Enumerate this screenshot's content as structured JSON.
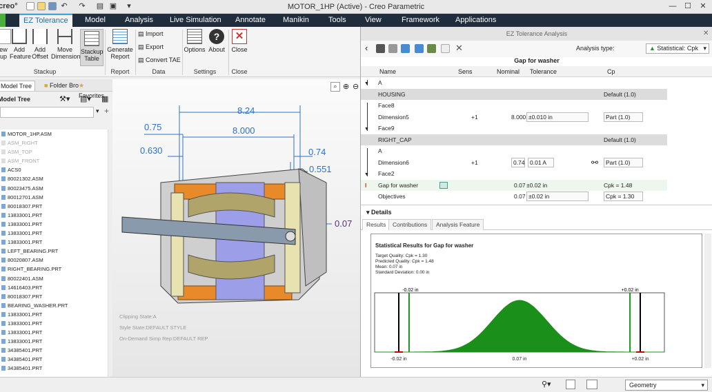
{
  "app": {
    "logo": "creo°",
    "title": "MOTOR_1HP (Active) - Creo Parametric"
  },
  "menu": [
    "EZ Tolerance",
    "Model",
    "Analysis",
    "Live Simulation",
    "Annotate",
    "Manikin",
    "Tools",
    "View",
    "Framework",
    "Applications"
  ],
  "ribbon": {
    "buttons": [
      {
        "label": "ew",
        "label2": "up"
      },
      {
        "label": "Add",
        "label2": "Feature"
      },
      {
        "label": "Add",
        "label2": "Offset"
      },
      {
        "label": "Move",
        "label2": "Dimension"
      },
      {
        "label": "Stackup",
        "label2": "Table"
      },
      {
        "label": "Generate",
        "label2": "Report"
      },
      {
        "label": "Options",
        "label2": ""
      },
      {
        "label": "About",
        "label2": ""
      },
      {
        "label": "Close",
        "label2": ""
      }
    ],
    "data_items": [
      "Import",
      "Export",
      "Convert TAE"
    ],
    "groups": [
      "Stackup",
      "Report",
      "Data",
      "Settings",
      "Close"
    ]
  },
  "left": {
    "tabs": [
      "Model Tree",
      "Folder Bro",
      "Favorites"
    ],
    "tree_title": "Model Tree",
    "tree": [
      {
        "label": "MOTOR_1HP.ASM",
        "dim": false
      },
      {
        "label": "ASM_RIGHT",
        "dim": true
      },
      {
        "label": "ASM_TOP",
        "dim": true
      },
      {
        "label": "ASM_FRONT",
        "dim": true
      },
      {
        "label": "ACS0",
        "dim": false
      },
      {
        "label": "80021302.ASM",
        "dim": false
      },
      {
        "label": "80023475.ASM",
        "dim": false
      },
      {
        "label": "80012701.ASM",
        "dim": false
      },
      {
        "label": "80018307.PRT",
        "dim": false
      },
      {
        "label": "13833001.PRT",
        "dim": false
      },
      {
        "label": "13833001.PRT",
        "dim": false
      },
      {
        "label": "13833001.PRT",
        "dim": false
      },
      {
        "label": "13833001.PRT",
        "dim": false
      },
      {
        "label": "LEFT_BEARING.PRT",
        "dim": false
      },
      {
        "label": "80020807.ASM",
        "dim": false
      },
      {
        "label": "RIGHT_BEARING.PRT",
        "dim": false
      },
      {
        "label": "80022401.ASM",
        "dim": false
      },
      {
        "label": "14616403.PRT",
        "dim": false
      },
      {
        "label": "80018307.PRT",
        "dim": false
      },
      {
        "label": "BEARING_WASHER.PRT",
        "dim": false
      },
      {
        "label": "13833001.PRT",
        "dim": false
      },
      {
        "label": "13833001.PRT",
        "dim": false
      },
      {
        "label": "13833001.PRT",
        "dim": false
      },
      {
        "label": "13833001.PRT",
        "dim": false
      },
      {
        "label": "34385401.PRT",
        "dim": false
      },
      {
        "label": "34385401.PRT",
        "dim": false
      },
      {
        "label": "34385401.PRT",
        "dim": false
      }
    ]
  },
  "graphics": {
    "dims": {
      "d1": "8.24",
      "d2": "8.000",
      "d3": "0.75",
      "d4": "0.630",
      "d5": "0.74",
      "d6": "0.551",
      "d7": "0.07"
    },
    "states": [
      "Clipping State:A",
      "Style State:DEFAULT STYLE",
      "On-Demand Simp Rep:DEFAULT REP"
    ]
  },
  "panel": {
    "title": "EZ Tolerance Analysis",
    "analysis_type_label": "Analysis type:",
    "analysis_type_value": "Statistical: Cpk",
    "gap_title": "Gap for washer",
    "columns": [
      "Name",
      "Sens",
      "Nominal",
      "Tolerance",
      "Cp"
    ],
    "rows": [
      {
        "name": "A",
        "sens": "",
        "nominal": "",
        "tol": "",
        "cp": "",
        "kind": "plain"
      },
      {
        "name": "HOUSING",
        "sens": "",
        "nominal": "",
        "tol": "",
        "cp": "Default (1.0)",
        "kind": "grp"
      },
      {
        "name": "Face8",
        "sens": "",
        "nominal": "",
        "tol": "",
        "cp": "",
        "kind": "plain"
      },
      {
        "name": "Dimension5",
        "sens": "+1",
        "nominal": "8.000",
        "tol": "±0.010 in",
        "cp": "Part (1.0)",
        "kind": "dim"
      },
      {
        "name": "Face9",
        "sens": "",
        "nominal": "",
        "tol": "",
        "cp": "",
        "kind": "plain"
      },
      {
        "name": "RIGHT_CAP",
        "sens": "",
        "nominal": "",
        "tol": "",
        "cp": "Default (1.0)",
        "kind": "grp"
      },
      {
        "name": "A",
        "sens": "",
        "nominal": "",
        "tol": "",
        "cp": "",
        "kind": "plain"
      },
      {
        "name": "Dimension6",
        "sens": "+1",
        "nominal": "0.74",
        "tol": "0.01 A",
        "cp": "Part (1.0)",
        "kind": "dim2"
      },
      {
        "name": "Face2",
        "sens": "",
        "nominal": "",
        "tol": "",
        "cp": "",
        "kind": "plain"
      },
      {
        "name": "Gap for washer",
        "sens": "",
        "nominal": "0.07",
        "tol": "±0.02 in",
        "cp": "Cpk = 1.48",
        "kind": "sel"
      },
      {
        "name": "Objectives",
        "sens": "",
        "nominal": "0.07",
        "tol": "±0.02 in",
        "cp": "Cpk = 1.30",
        "kind": "obj"
      }
    ],
    "details_label": "Details",
    "result_tabs": [
      "Results",
      "Contributions",
      "Analysis Feature"
    ],
    "results": {
      "title": "Statistical Results for Gap for washer",
      "stats": [
        "Target Quality: Cpk = 1.30",
        "Predicted Quality: Cpk = 1.48",
        "Mean: 0.07 in",
        "Standard Deviation: 0.00 in"
      ]
    }
  },
  "chart_data": {
    "type": "area",
    "title": "Statistical Results for Gap for washer",
    "xlabel": "",
    "ylabel": "",
    "mean": 0.07,
    "std_dev_visual": 0.0045,
    "spec_lower_label": "-0.02 in",
    "spec_upper_label": "+0.02 in",
    "axis_labels": [
      "-0.02 in",
      "0.07 in",
      "+0.02 in"
    ],
    "x_range": [
      0.046,
      0.094
    ],
    "lower_limit_x": 0.05,
    "upper_limit_x": 0.09,
    "lower_target_x": 0.0517,
    "upper_target_x": 0.0883,
    "fill_color": "#1a8f1a",
    "limit_color": "#000000",
    "target_color": "#1a8f1a"
  },
  "status": {
    "filter": "Geometry"
  }
}
